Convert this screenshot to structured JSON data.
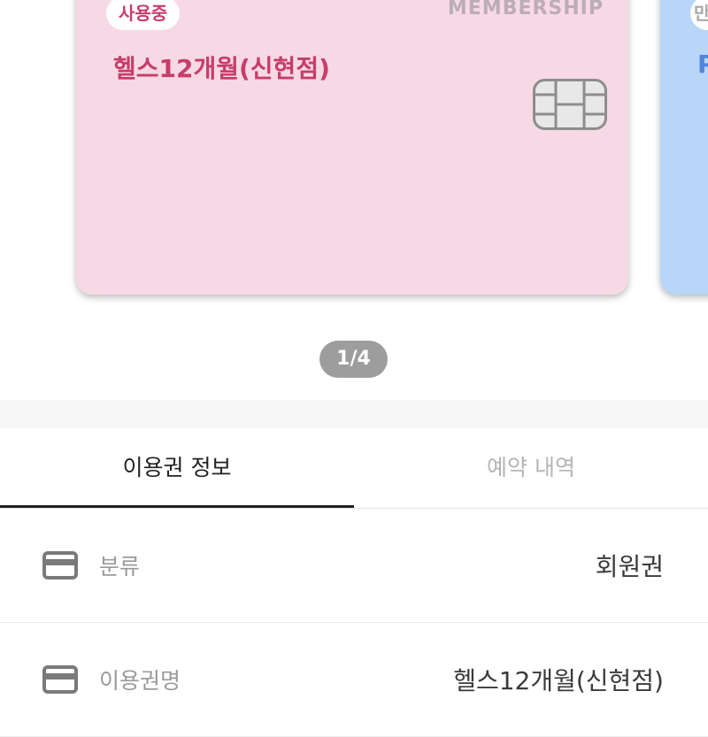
{
  "cards": [
    {
      "status_badge": "사용중",
      "brand": "MEMBERSHIP",
      "title": "헬스12개월(신현점)",
      "background": "#f6d9e5",
      "accent": "#c73d6b"
    },
    {
      "status_badge": "만",
      "title": "P",
      "background": "#b9d6f8",
      "accent": "#4f86dd"
    }
  ],
  "pager": {
    "text": "1/4"
  },
  "tabs": [
    {
      "label": "이용권 정보",
      "active": true
    },
    {
      "label": "예약 내역",
      "active": false
    }
  ],
  "rows": [
    {
      "icon": "credit-card-icon",
      "label": "분류",
      "value": "회원권"
    },
    {
      "icon": "credit-card-icon",
      "label": "이용권명",
      "value": "헬스12개월(신현점)"
    }
  ]
}
